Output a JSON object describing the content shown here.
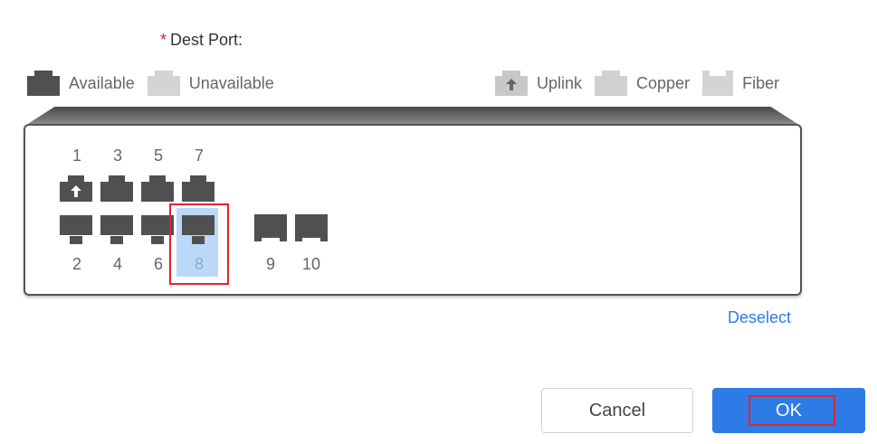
{
  "field": {
    "required_mark": "*",
    "label": "Dest Port:"
  },
  "legend": {
    "available": "Available",
    "unavailable": "Unavailable",
    "uplink": "Uplink",
    "copper": "Copper",
    "fiber": "Fiber"
  },
  "ports": {
    "top_numbers": [
      "1",
      "3",
      "5",
      "7"
    ],
    "bottom_numbers": [
      "2",
      "4",
      "6",
      "8"
    ],
    "fiber_numbers": [
      "9",
      "10"
    ],
    "selected": "8"
  },
  "actions": {
    "deselect": "Deselect",
    "cancel": "Cancel",
    "ok": "OK"
  },
  "colors": {
    "accent": "#2d7be6",
    "highlight_border": "#e3242b",
    "selected_fill": "#bcd8f8",
    "port_available": "#505050",
    "port_unavailable": "#d4d4d4"
  }
}
